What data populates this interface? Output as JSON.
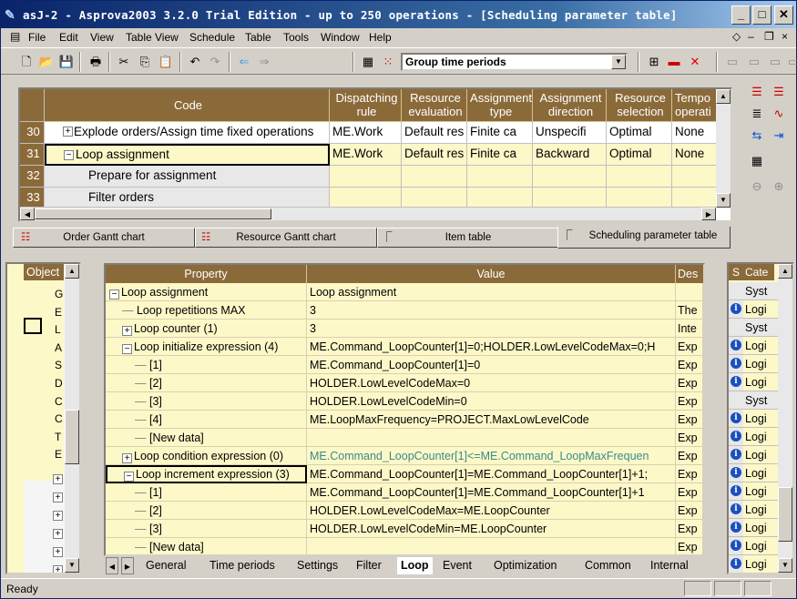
{
  "app": {
    "title": "asJ-2 - Asprova2003 3.2.0 Trial Edition  - up to 250 operations - [Scheduling parameter table]"
  },
  "menu": [
    "File",
    "Edit",
    "View",
    "Table View",
    "Schedule",
    "Table",
    "Tools",
    "Window",
    "Help"
  ],
  "toolbar": {
    "group_combo": "Group time periods"
  },
  "top_grid": {
    "headers": [
      "Code",
      "Dispatching rule",
      "Resource evaluation",
      "Assignment type",
      "Assignment direction",
      "Resource selection",
      "Tempo operati"
    ],
    "rows": [
      {
        "num": "30",
        "code": "Explode orders/Assign time fixed operations",
        "disp": "ME.Work",
        "eval": "Default res",
        "type": "Finite ca",
        "dir": "Unspecifi",
        "sel": "Optimal",
        "temp": "None"
      },
      {
        "num": "31",
        "code": "Loop assignment",
        "disp": "ME.Work",
        "eval": "Default res",
        "type": "Finite ca",
        "dir": "Backward",
        "sel": "Optimal",
        "temp": "None"
      },
      {
        "num": "32",
        "code": "Prepare for assignment",
        "disp": "",
        "eval": "",
        "type": "",
        "dir": "",
        "sel": "",
        "temp": ""
      },
      {
        "num": "33",
        "code": "Filter orders",
        "disp": "",
        "eval": "",
        "type": "",
        "dir": "",
        "sel": "",
        "temp": ""
      }
    ]
  },
  "view_tabs": [
    "Order Gantt chart",
    "Resource Gantt chart",
    "Item table",
    "Scheduling parameter table"
  ],
  "object_panel": {
    "header": "Object",
    "letters": [
      "G",
      "E",
      "L",
      "A",
      "S",
      "D",
      "C",
      "C",
      "T",
      "E"
    ]
  },
  "prop_table": {
    "headers": [
      "Property",
      "Value",
      "Des"
    ],
    "rows": [
      {
        "prop": "Loop assignment",
        "value": "Loop assignment",
        "des": "",
        "indent": 0,
        "box": "-"
      },
      {
        "prop": "Loop repetitions MAX",
        "value": "3",
        "des": "The",
        "indent": 1,
        "box": ""
      },
      {
        "prop": "Loop counter (1)",
        "value": "3",
        "des": "Inte",
        "indent": 1,
        "box": "+"
      },
      {
        "prop": "Loop initialize expression (4)",
        "value": "ME.Command_LoopCounter[1]=0;HOLDER.LowLevelCodeMax=0;H",
        "des": "Exp",
        "indent": 1,
        "box": "-"
      },
      {
        "prop": "[1]",
        "value": "ME.Command_LoopCounter[1]=0",
        "des": "Exp",
        "indent": 2,
        "box": ""
      },
      {
        "prop": "[2]",
        "value": "HOLDER.LowLevelCodeMax=0",
        "des": "Exp",
        "indent": 2,
        "box": ""
      },
      {
        "prop": "[3]",
        "value": "HOLDER.LowLevelCodeMin=0",
        "des": "Exp",
        "indent": 2,
        "box": ""
      },
      {
        "prop": "[4]",
        "value": "ME.LoopMaxFrequency=PROJECT.MaxLowLevelCode",
        "des": "Exp",
        "indent": 2,
        "box": ""
      },
      {
        "prop": "[New data]",
        "value": "",
        "des": "Exp",
        "indent": 2,
        "box": ""
      },
      {
        "prop": "Loop condition expression (0)",
        "value": "ME.Command_LoopCounter[1]<=ME.Command_LoopMaxFrequen",
        "des": "Exp",
        "indent": 1,
        "box": "+"
      },
      {
        "prop": "Loop increment expression (3)",
        "value": "ME.Command_LoopCounter[1]=ME.Command_LoopCounter[1]+1;",
        "des": "Exp",
        "indent": 1,
        "box": "-"
      },
      {
        "prop": "[1]",
        "value": "ME.Command_LoopCounter[1]=ME.Command_LoopCounter[1]+1",
        "des": "Exp",
        "indent": 2,
        "box": ""
      },
      {
        "prop": "[2]",
        "value": "HOLDER.LowLevelCodeMax=ME.LoopCounter",
        "des": "Exp",
        "indent": 2,
        "box": ""
      },
      {
        "prop": "[3]",
        "value": "HOLDER.LowLevelCodeMin=ME.LoopCounter",
        "des": "Exp",
        "indent": 2,
        "box": ""
      },
      {
        "prop": "[New data]",
        "value": "",
        "des": "Exp",
        "indent": 2,
        "box": ""
      }
    ]
  },
  "prop_tabs": [
    "General",
    "Time periods",
    "Settings",
    "Filter",
    "Loop",
    "Event",
    "Optimization",
    "Common",
    "Internal"
  ],
  "right_panel": {
    "headers": [
      "S",
      "Cate"
    ],
    "rows": [
      {
        "icon": "",
        "cat": "Syst"
      },
      {
        "icon": "i",
        "cat": "Logi"
      },
      {
        "icon": "",
        "cat": "Syst"
      },
      {
        "icon": "i",
        "cat": "Logi"
      },
      {
        "icon": "i",
        "cat": "Logi"
      },
      {
        "icon": "i",
        "cat": "Logi"
      },
      {
        "icon": "",
        "cat": "Syst"
      },
      {
        "icon": "i",
        "cat": "Logi"
      },
      {
        "icon": "i",
        "cat": "Logi"
      },
      {
        "icon": "i",
        "cat": "Logi"
      },
      {
        "icon": "i",
        "cat": "Logi"
      },
      {
        "icon": "i",
        "cat": "Logi"
      },
      {
        "icon": "i",
        "cat": "Logi"
      },
      {
        "icon": "i",
        "cat": "Logi"
      },
      {
        "icon": "i",
        "cat": "Logi"
      },
      {
        "icon": "i",
        "cat": "Logi"
      }
    ]
  },
  "status": {
    "text": "Ready"
  }
}
